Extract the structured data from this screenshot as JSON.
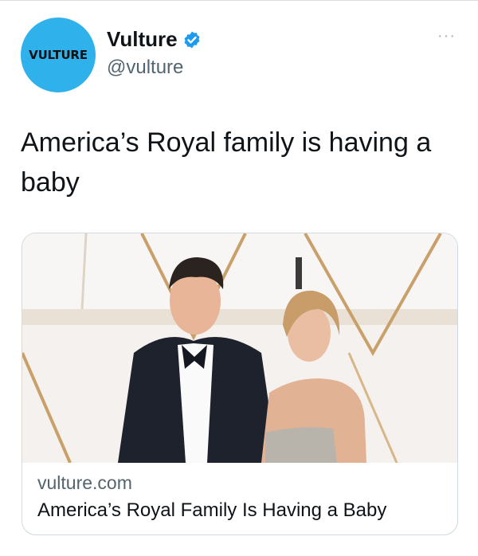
{
  "author": {
    "avatar_text": "VULTURE",
    "display_name": "Vulture",
    "handle": "@vulture",
    "verified": true
  },
  "more_icon": "···",
  "tweet": {
    "text": "America’s Royal family is having a baby"
  },
  "card": {
    "image_description_icon": "photo",
    "domain": "vulture.com",
    "title": "America’s Royal Family Is Having a Baby"
  },
  "colors": {
    "avatar_bg": "#2fb1ec",
    "verified_badge": "#1d9bf0",
    "secondary_text": "#536471"
  }
}
